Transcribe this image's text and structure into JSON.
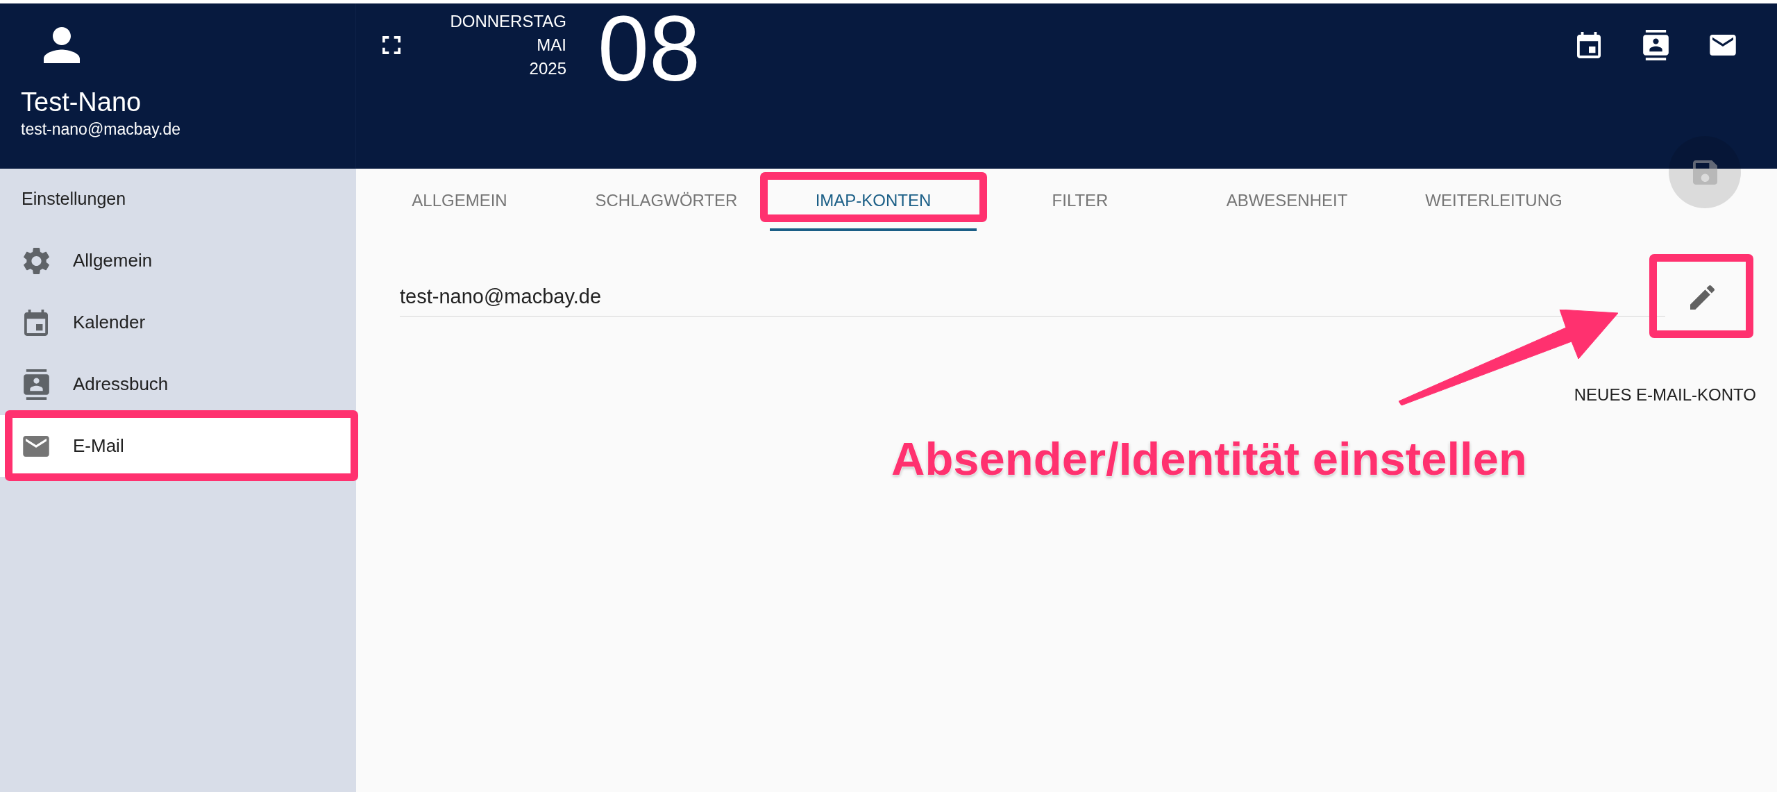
{
  "user": {
    "name": "Test-Nano",
    "email": "test-nano@macbay.de"
  },
  "date": {
    "weekday": "DONNERSTAG",
    "month": "MAI",
    "year": "2025",
    "day": "08"
  },
  "sidebar": {
    "title": "Einstellungen",
    "items": [
      {
        "label": "Allgemein",
        "selected": false,
        "highlighted": false
      },
      {
        "label": "Kalender",
        "selected": false,
        "highlighted": false
      },
      {
        "label": "Adressbuch",
        "selected": false,
        "highlighted": false
      },
      {
        "label": "E-Mail",
        "selected": true,
        "highlighted": true
      }
    ]
  },
  "tabs": [
    {
      "label": "ALLGEMEIN",
      "selected": false,
      "highlighted": false
    },
    {
      "label": "SCHLAGWÖRTER",
      "selected": false,
      "highlighted": false
    },
    {
      "label": "IMAP-KONTEN",
      "selected": true,
      "highlighted": true
    },
    {
      "label": "FILTER",
      "selected": false,
      "highlighted": false
    },
    {
      "label": "ABWESENHEIT",
      "selected": false,
      "highlighted": false
    },
    {
      "label": "WEITERLEITUNG",
      "selected": false,
      "highlighted": false
    }
  ],
  "accounts": [
    {
      "email": "test-nano@macbay.de",
      "edit_highlighted": true
    }
  ],
  "new_account_button": {
    "label": "NEUES E-MAIL-KONTO"
  },
  "save_button": {
    "disabled": true
  },
  "annotation": {
    "callout": "Absender/Identität einstellen"
  }
}
